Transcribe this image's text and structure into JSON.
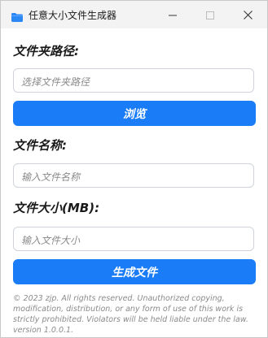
{
  "window": {
    "title": "任意大小文件生成器"
  },
  "form": {
    "folder_label": "文件夹路径:",
    "folder_placeholder": "选择文件夹路径",
    "browse_label": "浏览",
    "name_label": "文件名称:",
    "name_placeholder": "输入文件名称",
    "size_label": "文件大小(MB):",
    "size_placeholder": "输入文件大小",
    "generate_label": "生成文件"
  },
  "footer": {
    "copyright": "© 2023 zjp. All rights reserved. Unauthorized copying, modification, distribution, or any form of use of this work is strictly prohibited. Violators will be held liable under the law. version 1.0.0.1."
  },
  "colors": {
    "accent": "#1a7cf6",
    "folder_icon": "#2b88f5"
  },
  "icons": {
    "app": "folder-icon",
    "minimize": "minimize-icon",
    "maximize": "maximize-icon",
    "close": "close-icon"
  }
}
